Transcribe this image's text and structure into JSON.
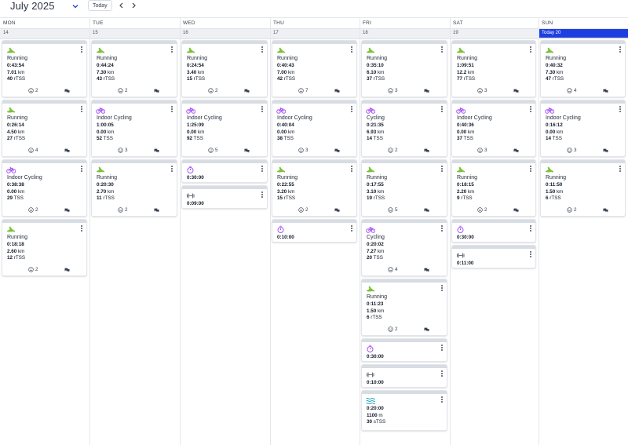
{
  "header": {
    "month_title": "July 2025",
    "today_label": "Today"
  },
  "days": [
    {
      "name": "MON",
      "date": "14"
    },
    {
      "name": "TUE",
      "date": "15"
    },
    {
      "name": "WED",
      "date": "16"
    },
    {
      "name": "THU",
      "date": "17"
    },
    {
      "name": "FRI",
      "date": "18"
    },
    {
      "name": "SAT",
      "date": "19"
    },
    {
      "name": "SUN",
      "date": "Today 20",
      "today": true
    }
  ],
  "colors": {
    "today_accent": "#1d3fe0",
    "run_icon": "#6dbb2a",
    "cycle_icon": "#a855f7",
    "timer_icon": "#a855f7",
    "swim_icon": "#22a6c7"
  },
  "workouts": [
    [
      {
        "sport": "run",
        "title": "Running",
        "lines": [
          [
            "0:43:54",
            ""
          ],
          [
            "7.01",
            "km"
          ],
          [
            "40",
            "rTSS"
          ]
        ],
        "reactions": "2"
      },
      {
        "sport": "run",
        "title": "Running",
        "lines": [
          [
            "0:26:14",
            ""
          ],
          [
            "4.50",
            "km"
          ],
          [
            "27",
            "rTSS"
          ]
        ],
        "reactions": "4"
      },
      {
        "sport": "cycle",
        "title": "Indoor Cycling",
        "lines": [
          [
            "0:38:38",
            ""
          ],
          [
            "0.00",
            "km"
          ],
          [
            "29",
            "TSS"
          ]
        ],
        "reactions": "2"
      },
      {
        "sport": "run",
        "title": "Running",
        "lines": [
          [
            "0:18:18",
            ""
          ],
          [
            "2.60",
            "km"
          ],
          [
            "12",
            "rTSS"
          ]
        ],
        "reactions": "2"
      }
    ],
    [
      {
        "sport": "run",
        "title": "Running",
        "lines": [
          [
            "0:44:24",
            ""
          ],
          [
            "7.30",
            "km"
          ],
          [
            "43",
            "rTSS"
          ]
        ],
        "reactions": "2"
      },
      {
        "sport": "cycle",
        "title": "Indoor Cycling",
        "lines": [
          [
            "1:00:05",
            ""
          ],
          [
            "0.00",
            "km"
          ],
          [
            "52",
            "TSS"
          ]
        ],
        "reactions": "3"
      },
      {
        "sport": "run",
        "title": "Running",
        "lines": [
          [
            "0:20:30",
            ""
          ],
          [
            "2.70",
            "km"
          ],
          [
            "11",
            "rTSS"
          ]
        ],
        "reactions": "2"
      }
    ],
    [
      {
        "sport": "run",
        "title": "Running",
        "lines": [
          [
            "0:24:54",
            ""
          ],
          [
            "3.40",
            "km"
          ],
          [
            "15",
            "rTSS"
          ]
        ],
        "reactions": "2"
      },
      {
        "sport": "cycle",
        "title": "Indoor Cycling",
        "lines": [
          [
            "1:25:09",
            ""
          ],
          [
            "0.00",
            "km"
          ],
          [
            "92",
            "TSS"
          ]
        ],
        "reactions": "5"
      },
      {
        "sport": "timer",
        "title": "",
        "lines": [
          [
            "0:30:00",
            ""
          ]
        ],
        "reactions": ""
      },
      {
        "sport": "strength",
        "title": "",
        "lines": [
          [
            "0:09:00",
            ""
          ]
        ],
        "reactions": ""
      }
    ],
    [
      {
        "sport": "run",
        "title": "Running",
        "lines": [
          [
            "0:40:43",
            ""
          ],
          [
            "7.00",
            "km"
          ],
          [
            "42",
            "rTSS"
          ]
        ],
        "reactions": "7"
      },
      {
        "sport": "cycle",
        "title": "Indoor Cycling",
        "lines": [
          [
            "0:40:04",
            ""
          ],
          [
            "0.00",
            "km"
          ],
          [
            "38",
            "TSS"
          ]
        ],
        "reactions": "3"
      },
      {
        "sport": "run",
        "title": "Running",
        "lines": [
          [
            "0:22:55",
            ""
          ],
          [
            "3.20",
            "km"
          ],
          [
            "15",
            "rTSS"
          ]
        ],
        "reactions": "2"
      },
      {
        "sport": "timer",
        "title": "",
        "lines": [
          [
            "0:10:00",
            ""
          ]
        ],
        "reactions": ""
      }
    ],
    [
      {
        "sport": "run",
        "title": "Running",
        "lines": [
          [
            "0:35:10",
            ""
          ],
          [
            "6.10",
            "km"
          ],
          [
            "37",
            "rTSS"
          ]
        ],
        "reactions": "3"
      },
      {
        "sport": "cycle",
        "title": "Cycling",
        "lines": [
          [
            "0:21:35",
            ""
          ],
          [
            "6.93",
            "km"
          ],
          [
            "14",
            "TSS"
          ]
        ],
        "reactions": "2"
      },
      {
        "sport": "run",
        "title": "Running",
        "lines": [
          [
            "0:17:55",
            ""
          ],
          [
            "3.10",
            "km"
          ],
          [
            "19",
            "rTSS"
          ]
        ],
        "reactions": "5"
      },
      {
        "sport": "cycle",
        "title": "Cycling",
        "lines": [
          [
            "0:20:02",
            ""
          ],
          [
            "7.27",
            "km"
          ],
          [
            "20",
            "TSS"
          ]
        ],
        "reactions": "4"
      },
      {
        "sport": "run",
        "title": "Running",
        "lines": [
          [
            "0:11:23",
            ""
          ],
          [
            "1.50",
            "km"
          ],
          [
            "6",
            "rTSS"
          ]
        ],
        "reactions": "2"
      },
      {
        "sport": "timer",
        "title": "",
        "lines": [
          [
            "0:30:00",
            ""
          ]
        ],
        "reactions": ""
      },
      {
        "sport": "strength",
        "title": "",
        "lines": [
          [
            "0:10:00",
            ""
          ]
        ],
        "reactions": ""
      },
      {
        "sport": "swim",
        "title": "",
        "lines": [
          [
            "0:20:00",
            ""
          ],
          [
            "1100",
            "m"
          ],
          [
            "30",
            "sTSS"
          ]
        ],
        "reactions": ""
      }
    ],
    [
      {
        "sport": "run",
        "title": "Running",
        "lines": [
          [
            "1:09:51",
            ""
          ],
          [
            "12.2",
            "km"
          ],
          [
            "77",
            "rTSS"
          ]
        ],
        "reactions": "3"
      },
      {
        "sport": "cycle",
        "title": "Indoor Cycling",
        "lines": [
          [
            "0:40:36",
            ""
          ],
          [
            "0.00",
            "km"
          ],
          [
            "37",
            "TSS"
          ]
        ],
        "reactions": "3"
      },
      {
        "sport": "run",
        "title": "Running",
        "lines": [
          [
            "0:18:15",
            ""
          ],
          [
            "2.20",
            "km"
          ],
          [
            "9",
            "rTSS"
          ]
        ],
        "reactions": "2"
      },
      {
        "sport": "timer",
        "title": "",
        "lines": [
          [
            "0:30:00",
            ""
          ]
        ],
        "reactions": ""
      },
      {
        "sport": "strength",
        "title": "",
        "lines": [
          [
            "0:11:00",
            ""
          ]
        ],
        "reactions": ""
      }
    ],
    [
      {
        "sport": "run",
        "title": "Running",
        "lines": [
          [
            "0:40:32",
            ""
          ],
          [
            "7.30",
            "km"
          ],
          [
            "47",
            "rTSS"
          ]
        ],
        "reactions": "4"
      },
      {
        "sport": "cycle",
        "title": "Indoor Cycling",
        "lines": [
          [
            "0:16:12",
            ""
          ],
          [
            "0.00",
            "km"
          ],
          [
            "14",
            "TSS"
          ]
        ],
        "reactions": "3"
      },
      {
        "sport": "run",
        "title": "Running",
        "lines": [
          [
            "0:11:50",
            ""
          ],
          [
            "1.50",
            "km"
          ],
          [
            "6",
            "rTSS"
          ]
        ],
        "reactions": "2"
      }
    ]
  ]
}
